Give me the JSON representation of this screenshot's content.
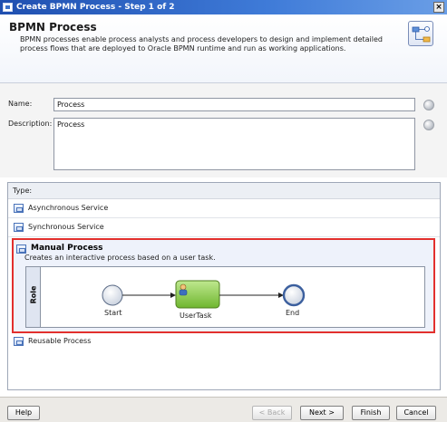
{
  "window": {
    "title": "Create BPMN Process - Step 1 of 2",
    "close_glyph": "×"
  },
  "header": {
    "title": "BPMN Process",
    "description": "BPMN processes enable process analysts and process developers to design and implement detailed process flows that are deployed to Oracle BPMN runtime and run as working applications."
  },
  "form": {
    "name_label": "Name:",
    "name_value": "Process",
    "description_label": "Description:",
    "description_value": "Process"
  },
  "types": {
    "header": "Type:",
    "items": [
      {
        "label": "Asynchronous Service"
      },
      {
        "label": "Synchronous Service"
      },
      {
        "label": "Reusable Process"
      }
    ],
    "selected": {
      "label": "Manual Process",
      "description": "Creates an interactive process based on a user task.",
      "diagram": {
        "lane": "Role",
        "start_label": "Start",
        "task_label": "UserTask",
        "end_label": "End"
      }
    }
  },
  "buttons": {
    "help": "Help",
    "back": "< Back",
    "next": "Next >",
    "finish": "Finish",
    "cancel": "Cancel"
  },
  "colors": {
    "selection_border": "#e2302d",
    "task_fill": "#8ccf4d",
    "title_bar": "#2a5fc1"
  }
}
